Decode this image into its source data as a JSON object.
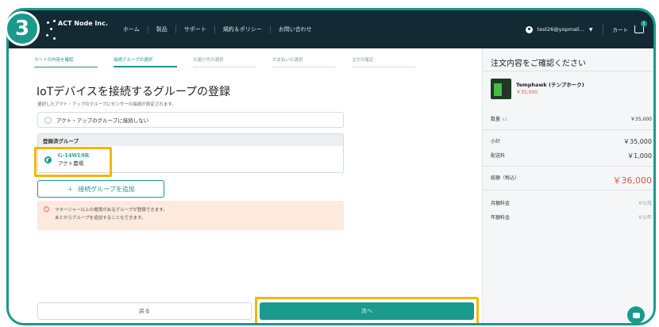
{
  "step_badge": "3",
  "header": {
    "brand": "ACT Node Inc.",
    "nav": [
      "ホーム",
      "製品",
      "サポート",
      "規約＆ポリシー",
      "お問い合わせ"
    ],
    "user_email": "test26@yopmail...",
    "cart_label": "カート",
    "cart_count": "1"
  },
  "steps": [
    {
      "label": "カートの内容を確認",
      "state": "done"
    },
    {
      "label": "接続グループの選択",
      "state": "active"
    },
    {
      "label": "お届け先の選択",
      "state": "pending"
    },
    {
      "label": "お支払いの選択",
      "state": "pending"
    },
    {
      "label": "注文の確定",
      "state": "pending"
    }
  ],
  "main": {
    "title": "IoTデバイスを接続するグループの登録",
    "subtitle": "選択したアクト・アップのグループにセンサーの接続が設定されます。",
    "no_group_option": "アクト・アップのグループに接続しない",
    "registered_header": "登録済グループ",
    "group_id": "G-14WL9R",
    "group_org": "アクト農場",
    "add_group_button": "接続グループを追加",
    "notice_line1": "マネージャー以上の権限があるグループが登録できます。",
    "notice_line2": "あとからグループを追加することもできます。",
    "back_button": "戻る",
    "next_button": "次へ"
  },
  "summary": {
    "title": "注文内容をご確認ください",
    "product_name": "Temphawk (テンプホーク)",
    "product_price": "￥35,000",
    "qty_label": "数量",
    "qty_value": "x1",
    "line_total": "￥35,000",
    "subtotal_label": "小計",
    "subtotal_value": "￥35,000",
    "shipping_label": "配送料",
    "shipping_value": "￥1,000",
    "total_label": "総額（税込）",
    "total_value": "￥36,000",
    "monthly_label": "月額料金",
    "monthly_value": "￥0/月",
    "yearly_label": "年額料金",
    "yearly_value": "￥0/年"
  },
  "colors": {
    "accent": "#1a9a8c",
    "header_bg": "#132a35",
    "highlight": "#f5b50a",
    "price": "#e05a3c"
  }
}
